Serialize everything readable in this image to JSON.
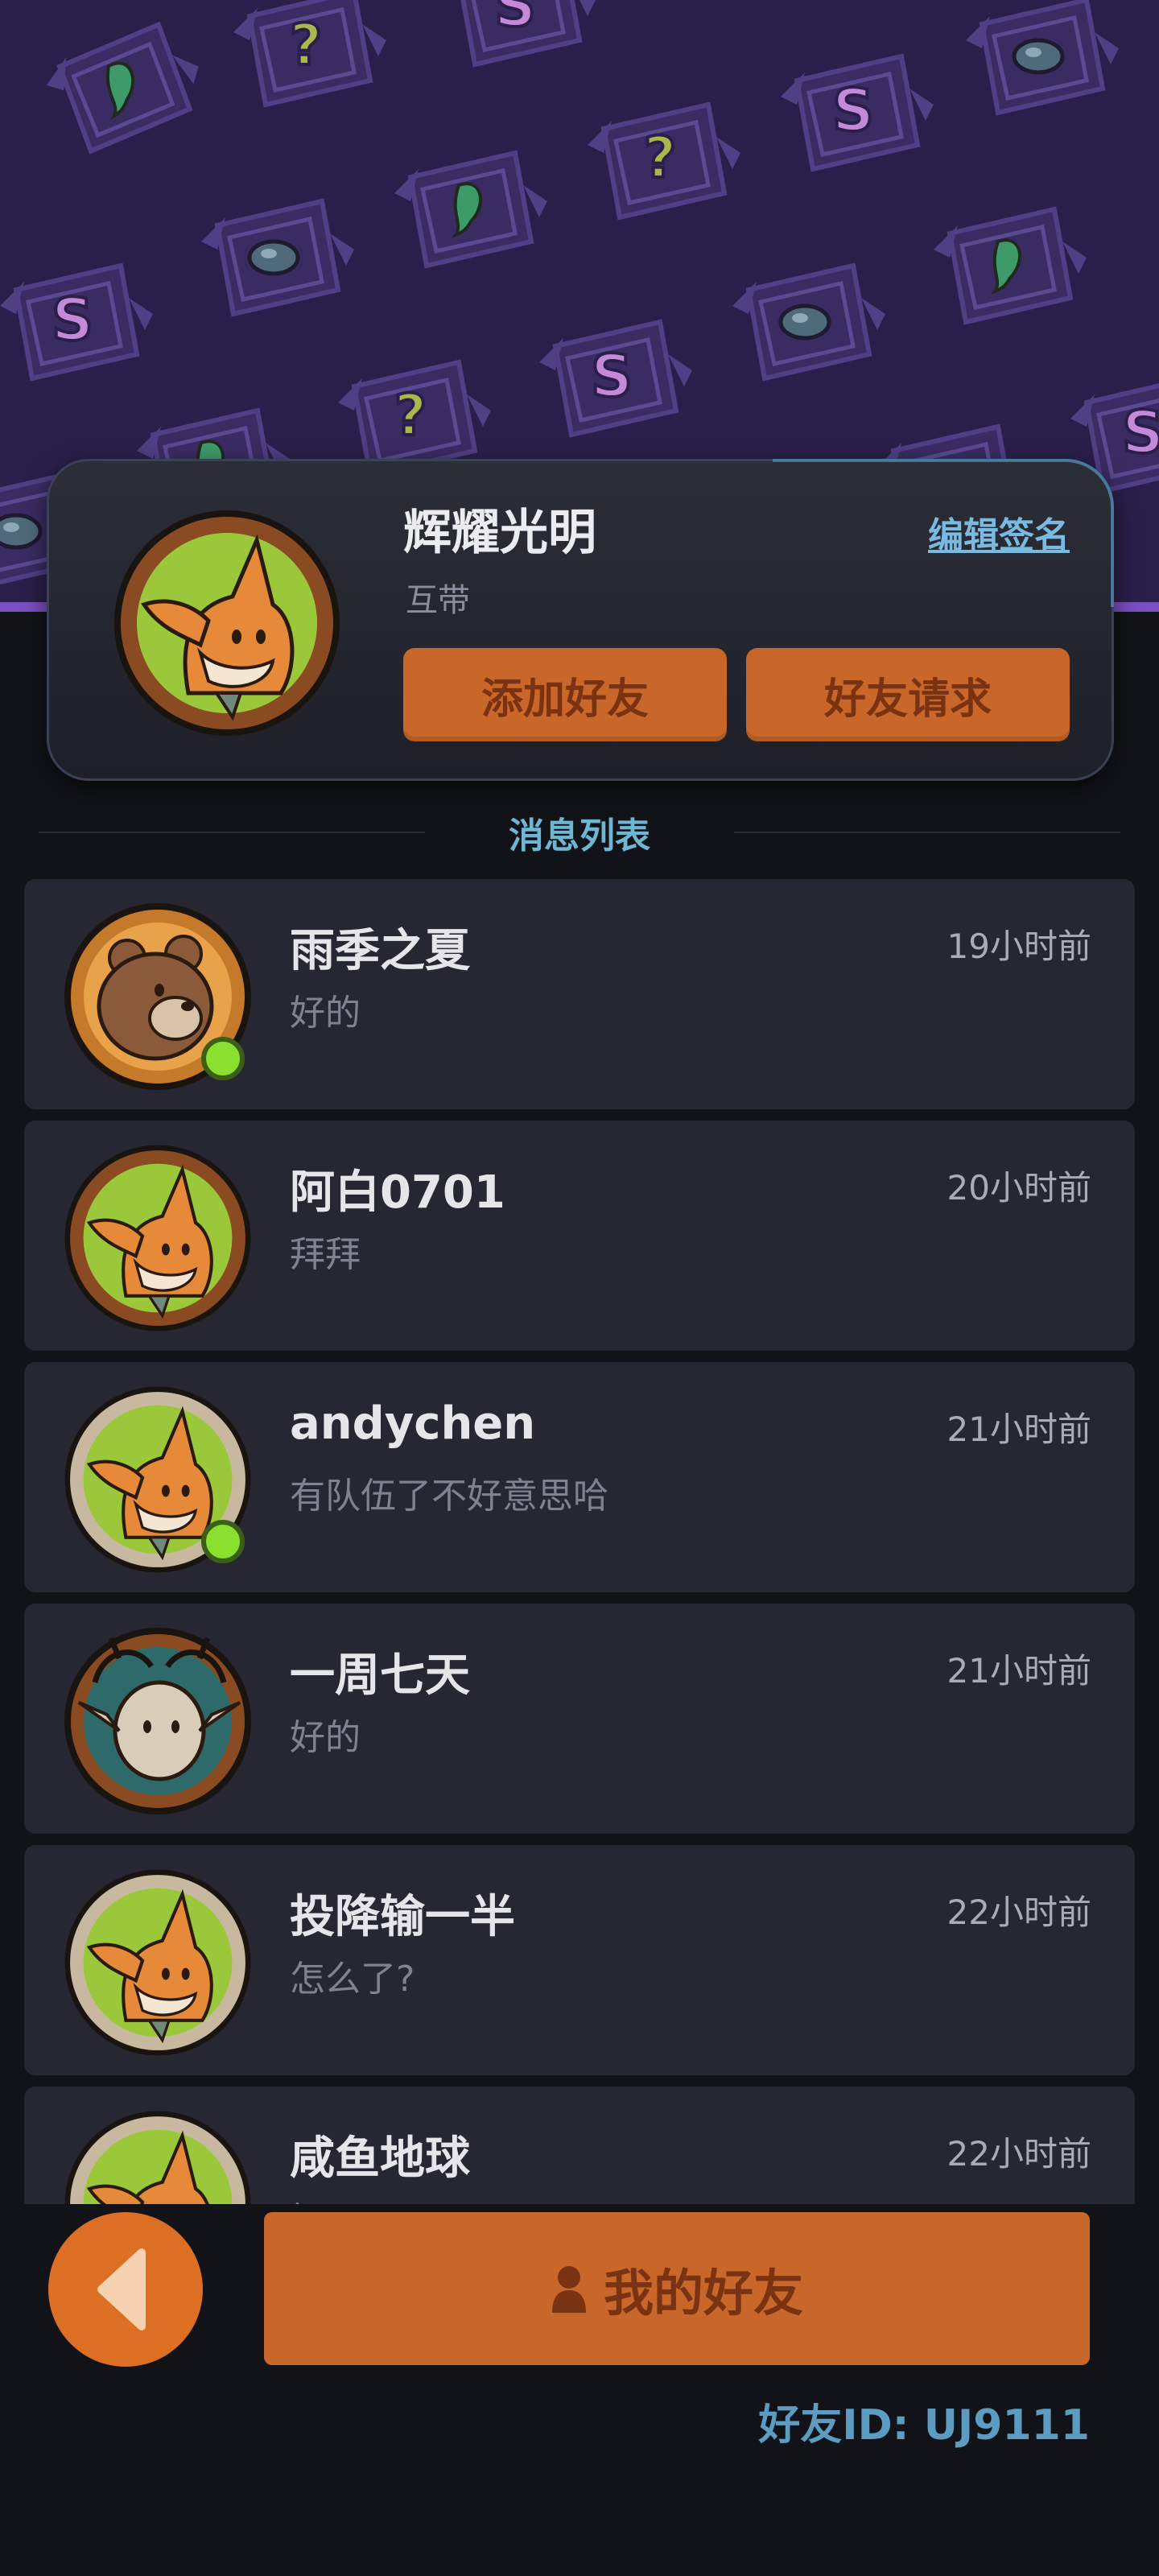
{
  "profile": {
    "name": "辉耀光明",
    "signature": "互带",
    "edit_signature_label": "编辑签名",
    "add_friend_label": "添加好友",
    "friend_request_label": "好友请求"
  },
  "section": {
    "title": "消息列表"
  },
  "messages": [
    {
      "name": "雨季之夏",
      "text": "好的",
      "time": "19小时前",
      "online": true,
      "avatar": "bear-avatar"
    },
    {
      "name": "阿白0701",
      "text": "拜拜",
      "time": "20小时前",
      "online": false,
      "avatar": "fox-avatar"
    },
    {
      "name": "andychen",
      "text": "有队伍了不好意思哈",
      "time": "21小时前",
      "online": true,
      "avatar": "fox-avatar"
    },
    {
      "name": "一周七天",
      "text": "好的",
      "time": "21小时前",
      "online": false,
      "avatar": "deer-avatar"
    },
    {
      "name": "投降输一半",
      "text": "怎么了?",
      "time": "22小时前",
      "online": false,
      "avatar": "fox-avatar"
    },
    {
      "name": "咸鱼地球",
      "text": "好hao吧",
      "time": "22小时前",
      "online": false,
      "avatar": "fox-avatar"
    }
  ],
  "bottom": {
    "back_icon": "back-arrow-icon",
    "my_friends_label": "我的好友",
    "friend_icon": "person-icon",
    "friend_id": "好友ID: UJ9111"
  },
  "colors": {
    "banner": "#2a1f4a",
    "accent_orange": "#c9672a",
    "online_green": "#8ae02f",
    "link_blue": "#7ab9e0"
  }
}
